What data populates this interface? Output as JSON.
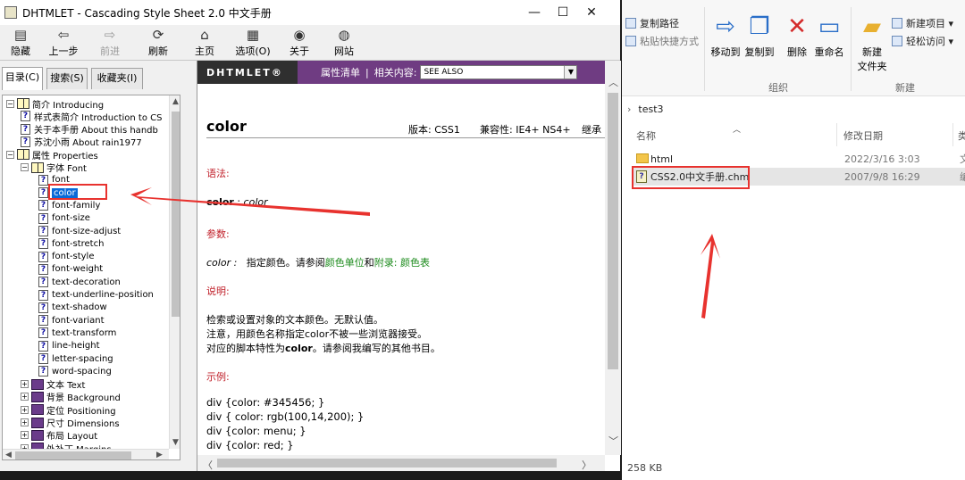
{
  "chm": {
    "title": "DHTMLET - Cascading Style Sheet 2.0 中文手册",
    "window_buttons": {
      "minimize": "—",
      "maximize": "☐",
      "close": "✕"
    },
    "toolbar": [
      {
        "label": "隐藏",
        "icon": "hide-icon",
        "glyph": "▤"
      },
      {
        "label": "上一步",
        "icon": "back-icon",
        "glyph": "⇦"
      },
      {
        "label": "前进",
        "icon": "forward-icon",
        "glyph": "⇨",
        "disabled": true
      },
      {
        "label": "刷新",
        "icon": "refresh-icon",
        "glyph": "⟳"
      },
      {
        "label": "主页",
        "icon": "home-icon",
        "glyph": "⌂"
      },
      {
        "label": "选项(O)",
        "icon": "options-icon",
        "glyph": "▦"
      },
      {
        "label": "关于",
        "icon": "about-icon",
        "glyph": "◉"
      },
      {
        "label": "网站",
        "icon": "website-icon",
        "glyph": "◍"
      }
    ],
    "nav_tabs": [
      "目录(C)",
      "搜索(S)",
      "收藏夹(I)"
    ],
    "tree": [
      {
        "depth": 0,
        "type": "book-open",
        "exp": "⊟",
        "label": "简介  Introducing"
      },
      {
        "depth": 1,
        "type": "page",
        "label": "样式表简介 Introduction to CS"
      },
      {
        "depth": 1,
        "type": "page",
        "label": "关于本手册 About this handb"
      },
      {
        "depth": 1,
        "type": "page",
        "label": "苏沈小雨 About rain1977"
      },
      {
        "depth": 0,
        "type": "book-open",
        "exp": "⊟",
        "label": "属性  Properties"
      },
      {
        "depth": 1,
        "type": "book-open",
        "exp": "⊟",
        "label": "字体  Font"
      },
      {
        "depth": 2,
        "type": "page",
        "label": "font"
      },
      {
        "depth": 2,
        "type": "page",
        "label": "color",
        "selected": true
      },
      {
        "depth": 2,
        "type": "page",
        "label": "font-family"
      },
      {
        "depth": 2,
        "type": "page",
        "label": "font-size"
      },
      {
        "depth": 2,
        "type": "page",
        "label": "font-size-adjust"
      },
      {
        "depth": 2,
        "type": "page",
        "label": "font-stretch"
      },
      {
        "depth": 2,
        "type": "page",
        "label": "font-style"
      },
      {
        "depth": 2,
        "type": "page",
        "label": "font-weight"
      },
      {
        "depth": 2,
        "type": "page",
        "label": "text-decoration"
      },
      {
        "depth": 2,
        "type": "page",
        "label": "text-underline-position"
      },
      {
        "depth": 2,
        "type": "page",
        "label": "text-shadow"
      },
      {
        "depth": 2,
        "type": "page",
        "label": "font-variant"
      },
      {
        "depth": 2,
        "type": "page",
        "label": "text-transform"
      },
      {
        "depth": 2,
        "type": "page",
        "label": "line-height"
      },
      {
        "depth": 2,
        "type": "page",
        "label": "letter-spacing"
      },
      {
        "depth": 2,
        "type": "page",
        "label": "word-spacing"
      },
      {
        "depth": 1,
        "type": "book-closed",
        "exp": "⊞",
        "label": "文本  Text"
      },
      {
        "depth": 1,
        "type": "book-closed",
        "exp": "⊞",
        "label": "背景  Background"
      },
      {
        "depth": 1,
        "type": "book-closed",
        "exp": "⊞",
        "label": "定位  Positioning"
      },
      {
        "depth": 1,
        "type": "book-closed",
        "exp": "⊞",
        "label": "尺寸  Dimensions"
      },
      {
        "depth": 1,
        "type": "book-closed",
        "exp": "⊞",
        "label": "布局  Layout"
      },
      {
        "depth": 1,
        "type": "book-closed",
        "exp": "⊞",
        "label": "外补丁  Margins"
      }
    ],
    "content": {
      "brand": "DHTMLET®",
      "prop_list": "属性清单",
      "divider": "|",
      "related": "相关内容:",
      "see_also": "SEE ALSO",
      "keyword": "color",
      "version": "版本: CSS1",
      "compat": "兼容性: IE4+ NS4+",
      "inherit": "继承",
      "syntax_head": "语法:",
      "syntax_kw": "color",
      "syntax_sep": " : ",
      "syntax_val": "color",
      "param_head": "参数:",
      "param_name": "color :",
      "param_text1": "指定颜色。请参阅",
      "param_link1": "颜色单位",
      "param_and": "和",
      "param_link2": "附录:",
      "param_link3": "颜色表",
      "desc_head": "说明:",
      "desc1": "检索或设置对象的文本颜色。无默认值。",
      "desc2": "注意，用颜色名称指定color不被一些浏览器接受。",
      "desc3_a": "对应的脚本特性为",
      "desc3_b": "color",
      "desc3_c": "。请参阅我编写的其他书目。",
      "example_head": "示例:",
      "examples": [
        "div {color: #345456; }",
        "div { color: rgb(100,14,200); }",
        "div {color: menu; }",
        "div {color: red; }"
      ]
    }
  },
  "explorer": {
    "ribbon": {
      "copy_path": "复制路径",
      "paste_shortcut": "粘贴快捷方式",
      "move_to": "移动到",
      "copy_to": "复制到",
      "delete": "删除",
      "rename": "重命名",
      "new_folder_1": "新建",
      "new_folder_2": "文件夹",
      "new_item": "新建项目 ▾",
      "easy_access": "轻松访问 ▾",
      "group_organize": "组织",
      "group_new": "新建"
    },
    "address": "test3",
    "columns": {
      "name": "名称",
      "modified": "修改日期",
      "extra": "类"
    },
    "files": [
      {
        "name": "html",
        "date": "2022/3/16 3:03",
        "more": "文",
        "kind": "folder"
      },
      {
        "name": "CSS2.0中文手册.chm",
        "date": "2007/9/8 16:29",
        "more": "编",
        "kind": "chm"
      }
    ],
    "status": "258 KB"
  },
  "colors": {
    "accent_red": "#e8322e",
    "header_purple": "#6f3c82",
    "section_red": "#c0202a",
    "link_green": "#1a8a1a"
  }
}
